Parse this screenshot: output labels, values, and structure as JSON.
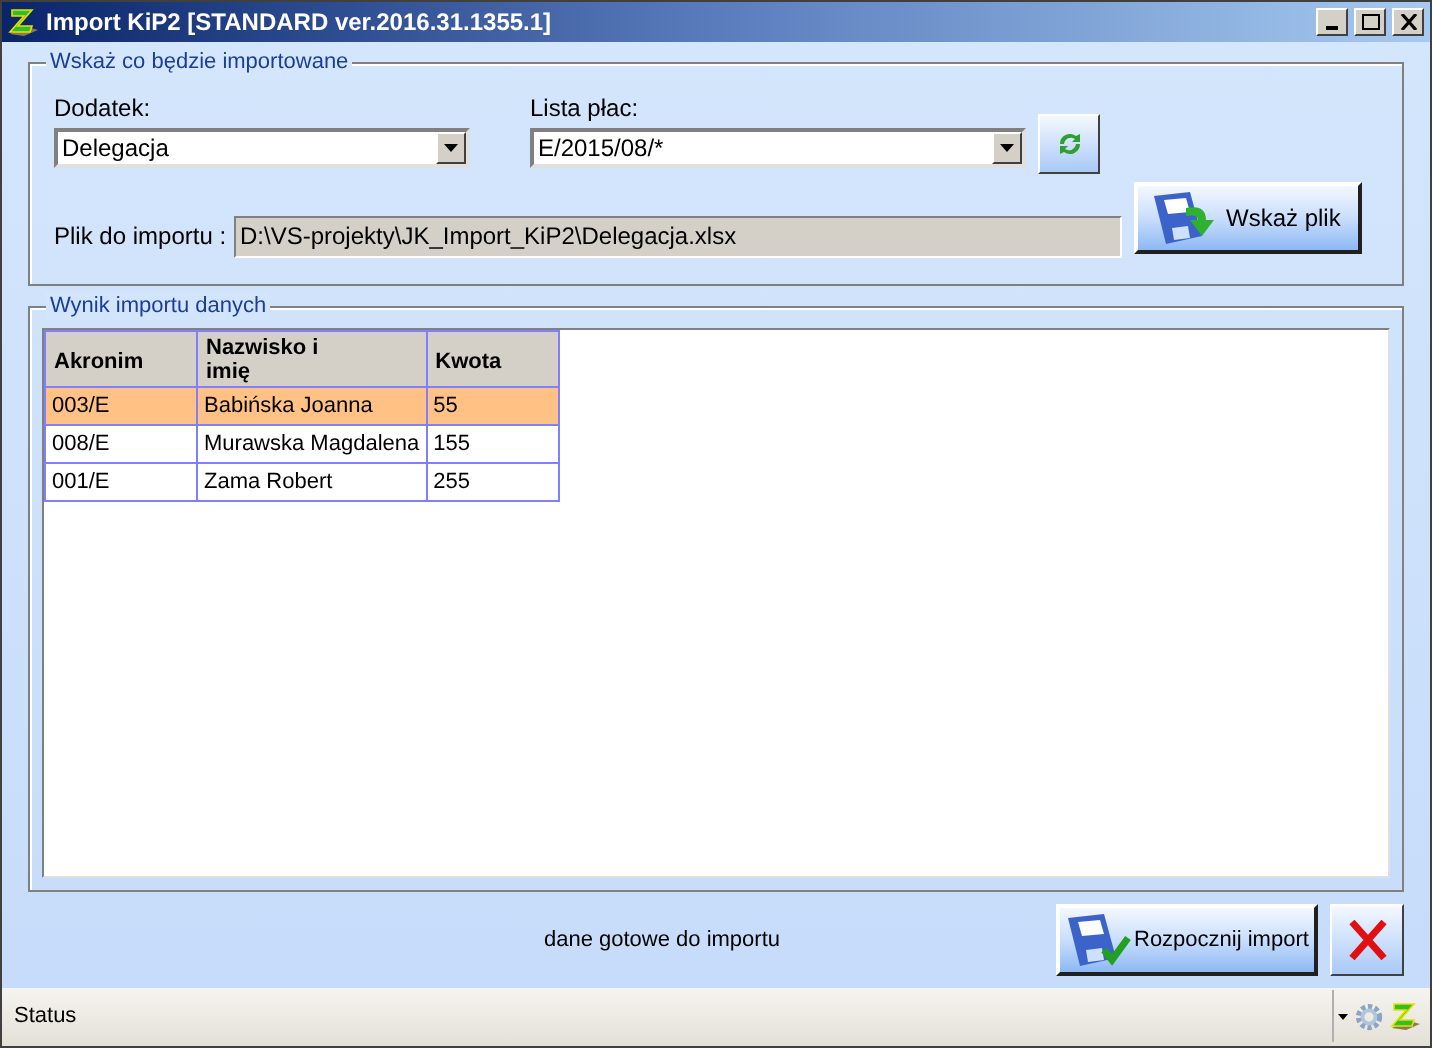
{
  "window": {
    "title": "Import KiP2 [STANDARD ver.2016.31.1355.1]"
  },
  "source_group": {
    "title": "Wskaż co będzie importowane",
    "addon_label": "Dodatek:",
    "addon_value": "Delegacja",
    "payroll_label": "Lista płac:",
    "payroll_value": "E/2015/08/*",
    "file_label": "Plik do importu :",
    "file_value": "D:\\VS-projekty\\JK_Import_KiP2\\Delegacja.xlsx",
    "browse_button": "Wskaż plik"
  },
  "result_group": {
    "title": "Wynik importu danych",
    "columns": [
      "Akronim",
      "Nazwisko i imię",
      "Kwota"
    ],
    "rows": [
      {
        "cells": [
          "003/E",
          "Babińska Joanna",
          "55"
        ],
        "selected": true
      },
      {
        "cells": [
          "008/E",
          "Murawska Magdalena",
          "155"
        ],
        "selected": false
      },
      {
        "cells": [
          "001/E",
          "Zama Robert",
          "255"
        ],
        "selected": false
      }
    ]
  },
  "message": "dane gotowe do importu",
  "start_button": "Rozpocznij import",
  "status_bar": {
    "text": "Status"
  }
}
